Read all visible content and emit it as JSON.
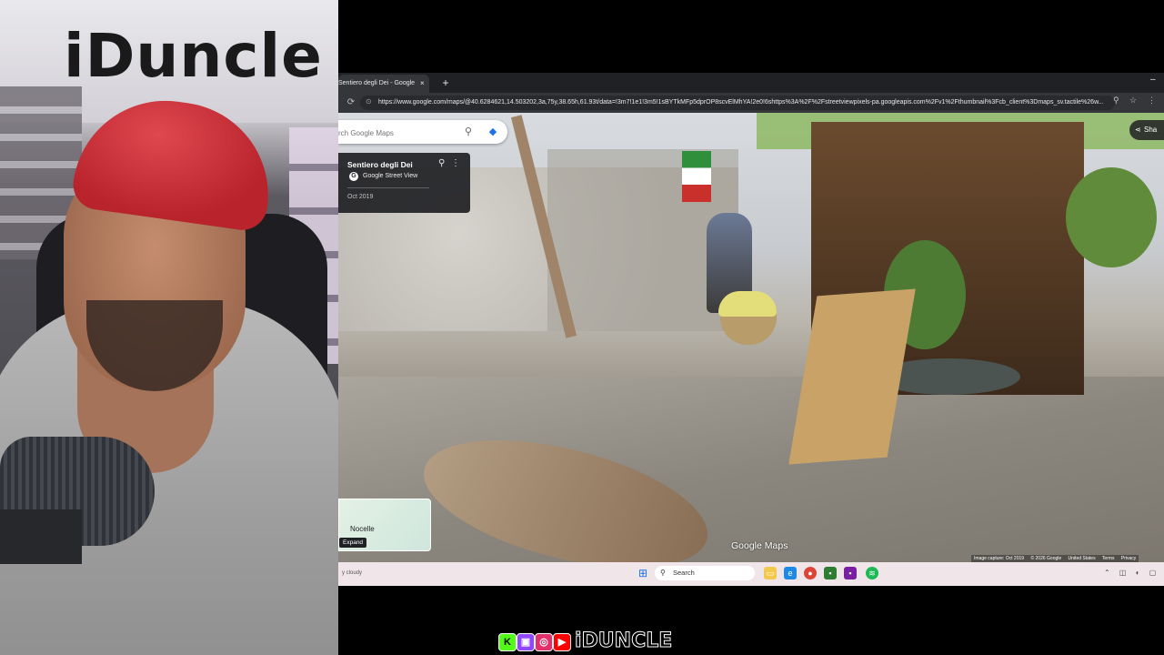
{
  "webcam": {
    "sign_text": "iDuncle"
  },
  "browser": {
    "tab": {
      "title": "Sentiero degli Dei - Google Ma",
      "close": "×"
    },
    "new_tab": "+",
    "url": "https://www.google.com/maps/@40.6284621,14.503202,3a,75y,38.65h,61.93t/data=!3m7!1e1!3m5!1sBYTkMFp5dprOP8scvElMhYA!2e0!6shttps%3A%2F%2Fstreetviewpixels-pa.googleapis.com%2Fv1%2Fthumbnail%3Fcb_client%3Dmaps_sv.tactile%26w..."
  },
  "maps": {
    "search": {
      "placeholder": "rch Google Maps"
    },
    "place_card": {
      "title": "Sentiero degli Dei",
      "source": "Google Street View",
      "date": "Oct 2019"
    },
    "share_label": "Sha",
    "minimap": {
      "place": "Nocelle",
      "expand_label": "Expand"
    },
    "watermark": "Google Maps",
    "attribution": {
      "capture": "Image capture: Oct 2019",
      "copyright": "© 2026 Google",
      "country": "United States",
      "terms": "Terms",
      "privacy": "Privacy"
    }
  },
  "taskbar": {
    "weather": "y cloudy",
    "search_label": "Search"
  },
  "branding": {
    "text": "iDUNCLE"
  },
  "icons": {
    "reload": "⟳",
    "lock": "⊙",
    "search": "⚲",
    "directions": "◆",
    "pin": "⚲",
    "more": "⋮",
    "share": "⋖",
    "start": "⊞",
    "zoom": "⚲"
  },
  "colors": {
    "accent": "#1a73e8",
    "kick": "#53fc18",
    "twitch": "#9146ff",
    "instagram": "#e1306c",
    "youtube": "#ff0000"
  }
}
